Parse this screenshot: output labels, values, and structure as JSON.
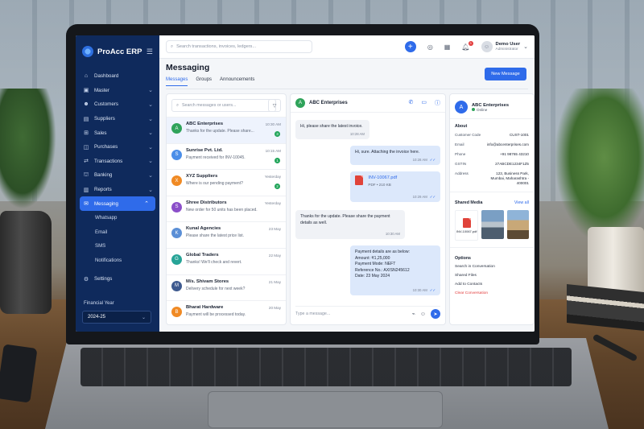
{
  "brand": {
    "name": "ProAcc ERP"
  },
  "topbar": {
    "search_placeholder": "Search transactions, invoices, ledgers...",
    "user_name": "Demo User",
    "user_role": "Administrator",
    "notification_count": "3"
  },
  "sidebar": {
    "items": [
      {
        "label": "Dashboard",
        "icon": "home-icon"
      },
      {
        "label": "Master",
        "icon": "cube-icon"
      },
      {
        "label": "Customers",
        "icon": "users-icon"
      },
      {
        "label": "Suppliers",
        "icon": "truck-icon"
      },
      {
        "label": "Sales",
        "icon": "cart-icon"
      },
      {
        "label": "Purchases",
        "icon": "bag-icon"
      },
      {
        "label": "Transactions",
        "icon": "swap-icon"
      },
      {
        "label": "Banking",
        "icon": "bank-icon"
      },
      {
        "label": "Reports",
        "icon": "chart-icon"
      },
      {
        "label": "Messaging",
        "icon": "message-icon"
      }
    ],
    "sub_items": [
      "Whatsapp",
      "Email",
      "SMS",
      "Notifications"
    ],
    "settings_label": "Settings",
    "financial_year_label": "Financial Year",
    "financial_year_value": "2024-25"
  },
  "page": {
    "title": "Messaging",
    "new_message_label": "New Message",
    "tabs": [
      "Messages",
      "Groups",
      "Announcements"
    ]
  },
  "list": {
    "search_placeholder": "Search messages or users...",
    "conversations": [
      {
        "initial": "A",
        "name": "ABC Enterprises",
        "time": "10:30 AM",
        "preview": "Thanks for the update. Please share...",
        "badge": "3",
        "color": "#2fa35a"
      },
      {
        "initial": "S",
        "name": "Sunrise Pvt. Ltd.",
        "time": "10:15 AM",
        "preview": "Payment received for INV-10045.",
        "badge": "1",
        "color": "#4b8ee8"
      },
      {
        "initial": "X",
        "name": "XYZ Suppliers",
        "time": "Yesterday",
        "preview": "Where is our pending payment?",
        "badge": "2",
        "color": "#f08a24"
      },
      {
        "initial": "S",
        "name": "Shree Distributors",
        "time": "Yesterday",
        "preview": "New order for 50 units has been placed.",
        "badge": "",
        "color": "#8b4fc9"
      },
      {
        "initial": "K",
        "name": "Kunal Agencies",
        "time": "23 May",
        "preview": "Please share the latest price list.",
        "badge": "",
        "color": "#5b8fd6"
      },
      {
        "initial": "G",
        "name": "Global Traders",
        "time": "22 May",
        "preview": "Thanks! We'll check and revert.",
        "badge": "",
        "color": "#27a497"
      },
      {
        "initial": "M",
        "name": "M/s. Shivam Stores",
        "time": "21 May",
        "preview": "Delivery schedule for next week?",
        "badge": "",
        "color": "#3e5a8f"
      },
      {
        "initial": "B",
        "name": "Bharat Hardware",
        "time": "20 May",
        "preview": "Payment will be processed today.",
        "badge": "",
        "color": "#f08a24"
      }
    ]
  },
  "chat": {
    "contact_initial": "A",
    "contact_name": "ABC Enterprises",
    "messages": [
      {
        "text": "Hi, please share the latest invoice.",
        "time": "10:28 AM"
      },
      {
        "text": "Hi, sure. Attaching the invoice here.",
        "time": "10:28 AM"
      },
      {
        "file_name": "INV-10067.pdf",
        "file_meta": "PDF • 210 KB",
        "time": "10:29 AM"
      },
      {
        "text": "Thanks for the update. Please share the payment details as well.",
        "time": "10:30 AM"
      },
      {
        "lines": [
          "Payment details are as below:",
          "Amount: ₹1,25,000",
          "Payment Mode: NEFT",
          "Reference No.: AXISN245612",
          "Date: 23 May 2024"
        ],
        "time": "10:30 AM"
      }
    ],
    "input_placeholder": "Type a message..."
  },
  "info": {
    "initial": "A",
    "name": "ABC Enterprises",
    "status": "Online",
    "about_title": "About",
    "fields": [
      {
        "k": "Customer Code",
        "v": "CUST-1001"
      },
      {
        "k": "Email",
        "v": "info@abcenterprises.com"
      },
      {
        "k": "Phone",
        "v": "+91 98765 43210"
      },
      {
        "k": "GSTIN",
        "v": "27ABCDE1234F1Z5"
      },
      {
        "k": "Address",
        "v": "123, Business Park, Mumbai, Maharashtra - 400001"
      }
    ],
    "shared_media_title": "Shared Media",
    "view_all": "View all",
    "media_file_name": "INV-10067.pdf",
    "options_title": "Options",
    "options": [
      "Search in Conversation",
      "Shared Files",
      "Add to Contacts",
      "Clear Conversation"
    ]
  },
  "colors": {
    "sidebar_bg": "#0f2a5c",
    "accent": "#2f6bea",
    "online": "#2fa35a",
    "danger": "#e23b3b"
  }
}
